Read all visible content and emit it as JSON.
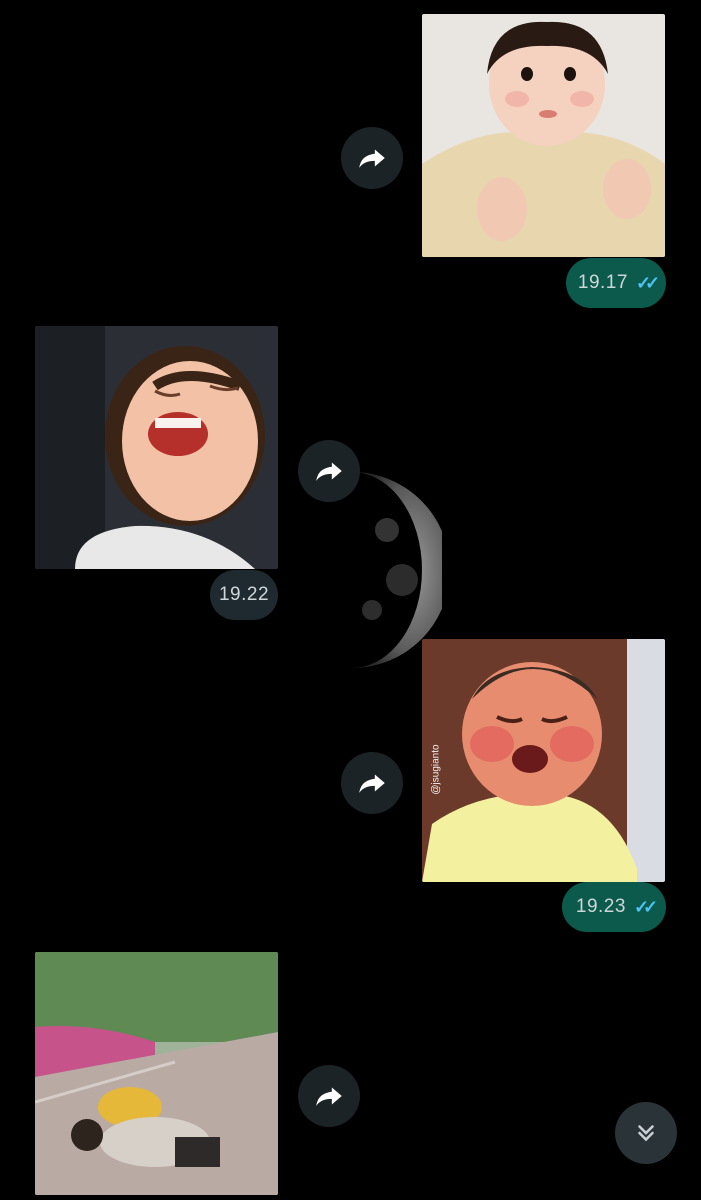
{
  "messages": [
    {
      "direction": "outgoing",
      "time": "19.17",
      "status": "read"
    },
    {
      "direction": "incoming",
      "time": "19.22"
    },
    {
      "direction": "outgoing",
      "time": "19.23",
      "status": "read",
      "watermark": "@jsugianto"
    },
    {
      "direction": "incoming"
    }
  ],
  "icons": {
    "forward": "forward-icon",
    "read_receipt": "double-check-icon",
    "scroll_down": "double-chevron-down-icon"
  },
  "colors": {
    "background": "#000000",
    "outgoing_bubble": "#0b5a4c",
    "incoming_bubble": "#1f2a30",
    "read_tick": "#4ec3f2"
  }
}
